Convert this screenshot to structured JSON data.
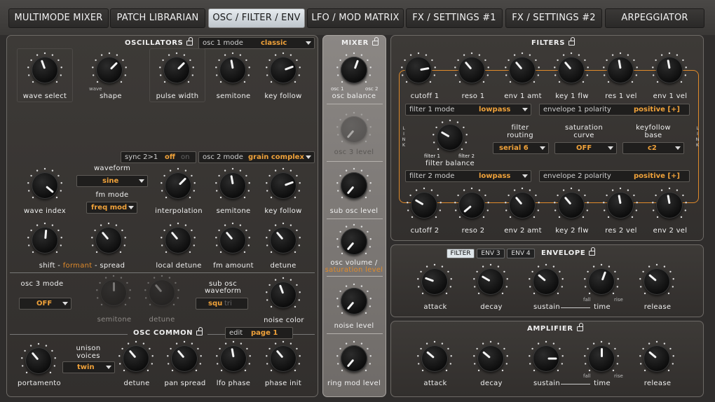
{
  "tabs": [
    {
      "label": "MULTIMODE MIXER",
      "active": false
    },
    {
      "label": "PATCH LIBRARIAN",
      "active": false
    },
    {
      "label": "OSC / FILTER / ENV",
      "active": true
    },
    {
      "label": "LFO / MOD MATRIX",
      "active": false
    },
    {
      "label": "FX / SETTINGS #1",
      "active": false
    },
    {
      "label": "FX / SETTINGS #2",
      "active": false
    },
    {
      "label": "ARPEGGIATOR",
      "active": false
    }
  ],
  "oscillators": {
    "title": "OSCILLATORS",
    "osc1_mode": {
      "label": "osc 1 mode",
      "value": "classic"
    },
    "row1": [
      "wave select",
      "shape",
      "pulse width",
      "semitone",
      "key follow"
    ],
    "shape_min": "wave",
    "sync": {
      "label": "sync 2>1",
      "off": "off",
      "on": "on"
    },
    "osc2_mode": {
      "label": "osc 2 mode",
      "value": "grain complex"
    },
    "waveform": {
      "label": "waveform",
      "value": "sine"
    },
    "fm_mode": {
      "label": "fm mode",
      "value": "freq mod"
    },
    "row2": [
      "wave index",
      "interpolation",
      "semitone",
      "key follow"
    ],
    "row3_shift": "shift - ",
    "row3_formant": "formant",
    "row3_spread": " - spread",
    "row3": [
      "local detune",
      "fm amount",
      "detune"
    ],
    "osc3_mode": {
      "label": "osc 3 mode",
      "value": "OFF"
    },
    "osc3_knobs": [
      "semitone",
      "detune"
    ],
    "sub_waveform": {
      "label1": "sub osc",
      "label2": "waveform",
      "squ": "squ",
      "tri": "tri"
    },
    "noise_color": "noise color"
  },
  "osc_common": {
    "title": "OSC COMMON",
    "edit": {
      "label": "edit",
      "value": "page 1"
    },
    "unison_label1": "unison",
    "unison_label2": "voices",
    "unison_value": "twin",
    "knobs": [
      "portamento",
      "detune",
      "pan spread",
      "lfo phase",
      "phase init"
    ]
  },
  "mixer": {
    "title": "MIXER",
    "osc1": "osc 1",
    "osc2": "osc 2",
    "knobs": [
      "osc balance",
      "osc 3 level",
      "sub osc level"
    ],
    "vol1": "osc volume /",
    "vol2": "saturation level",
    "knobs2": [
      "noise level",
      "ring mod level"
    ]
  },
  "filters": {
    "title": "FILTERS",
    "row1": [
      "cutoff 1",
      "reso 1",
      "env 1 amt",
      "key 1 flw",
      "res 1 vel",
      "env 1 vel"
    ],
    "filter1_mode": {
      "label": "filter 1 mode",
      "value": "lowpass"
    },
    "env1_pol": {
      "label": "envelope 1 polarity",
      "value": "positive [+]"
    },
    "balance": "filter balance",
    "bal_f1": "filter 1",
    "bal_f2": "filter 2",
    "routing": {
      "label1": "filter",
      "label2": "routing",
      "value": "serial 6"
    },
    "saturation": {
      "label1": "saturation",
      "label2": "curve",
      "value": "OFF"
    },
    "keyfollow": {
      "label1": "keyfollow",
      "label2": "base",
      "value": "c2"
    },
    "filter2_mode": {
      "label": "filter 2 mode",
      "value": "lowpass"
    },
    "env2_pol": {
      "label": "envelope 2 polarity",
      "value": "positive [+]"
    },
    "row2": [
      "cutoff 2",
      "reso 2",
      "env 2 amt",
      "key 2 flw",
      "res 2 vel",
      "env 2 vel"
    ],
    "link": "LINK"
  },
  "envelope": {
    "tabs": [
      "FILTER",
      "ENV 3",
      "ENV 4"
    ],
    "title": "ENVELOPE",
    "knobs": [
      "attack",
      "decay",
      "sustain",
      "time",
      "release"
    ],
    "fall": "fall",
    "rise": "rise"
  },
  "amplifier": {
    "title": "AMPLIFIER",
    "knobs": [
      "attack",
      "decay",
      "sustain",
      "time",
      "release"
    ],
    "fall": "fall",
    "rise": "rise"
  }
}
